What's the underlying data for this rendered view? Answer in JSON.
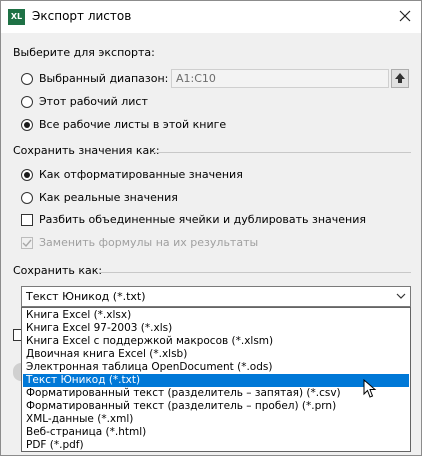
{
  "dialog": {
    "title": "Экспорт листов",
    "app_icon_text": "XL"
  },
  "export_section": {
    "heading": "Выберите для экспорта:",
    "options": [
      {
        "label": "Выбранный диапазон:",
        "selected": false
      },
      {
        "label": "Этот рабочий лист",
        "selected": false
      },
      {
        "label": "Все рабочие листы в этой книге",
        "selected": true
      }
    ],
    "range_value": "A1:C10"
  },
  "values_section": {
    "heading": "Сохранить значения как:",
    "options": [
      {
        "label": "Как отформатированные значения",
        "selected": true
      },
      {
        "label": "Как реальные значения",
        "selected": false
      }
    ],
    "split_merged_label": "Разбить объединенные ячейки и дублировать значения",
    "replace_formulas_label": "Заменить формулы на их результаты"
  },
  "save_as_section": {
    "heading": "Сохранить как:",
    "selected_format": "Текст Юникод (*.txt)",
    "formats": [
      "Книга Excel (*.xlsx)",
      "Книга Excel 97-2003 (*.xls)",
      "Книга Excel с поддержкой макросов (*.xlsm)",
      "Двоичная книга Excel (*.xlsb)",
      "Электронная таблица OpenDocument (*.ods)",
      "Текст Юникод (*.txt)",
      "Форматированный текст (разделитель – запятая) (*.csv)",
      "Форматированный текст (разделитель – пробел)  (*.prn)",
      "XML-данные (*.xml)",
      "Веб-страница (*.html)",
      "PDF (*.pdf)"
    ],
    "highlighted_index": 5
  },
  "colors": {
    "app_icon": "#1e7145",
    "selection": "#0078d7",
    "dialog_bg": "#f0f0f0"
  }
}
